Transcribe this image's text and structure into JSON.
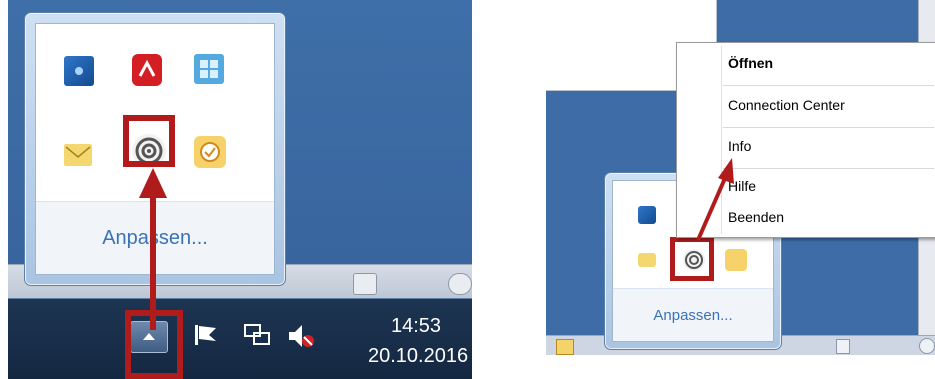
{
  "left_panel": {
    "popup": {
      "customize_link": "Anpassen..."
    },
    "clock": {
      "time": "14:53",
      "date": "20.10.2016"
    }
  },
  "right_panel": {
    "popup": {
      "customize_link": "Anpassen..."
    },
    "context_menu": {
      "items": [
        "Öffnen",
        "Connection Center",
        "Info",
        "Hilfe",
        "Beenden"
      ]
    }
  },
  "colors": {
    "highlight": "#b01c1c",
    "link": "#3b72b5",
    "desktop_blue": "#3d6ca7"
  }
}
